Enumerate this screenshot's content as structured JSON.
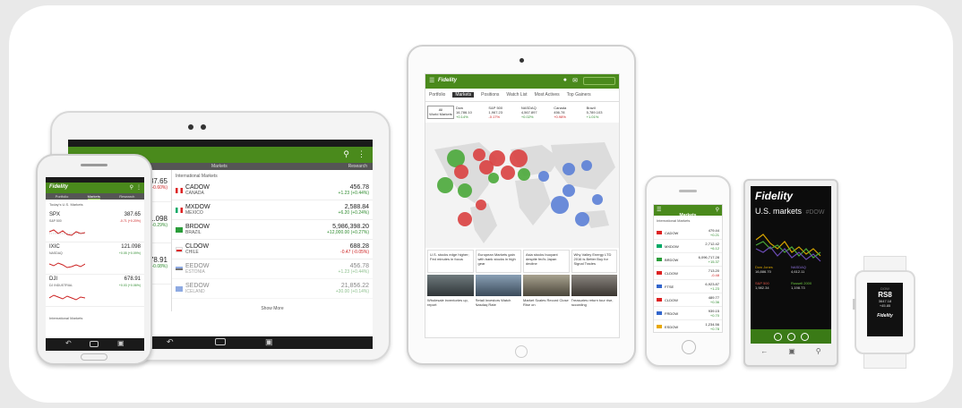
{
  "brand": "Fidelity",
  "tablet": {
    "bar_title": "Markets",
    "bar_right": "Research",
    "left_values": [
      {
        "value": "1,987.65",
        "change": "+11.86 (+0.60%)"
      },
      {
        "value": "4,321.098",
        "change": "+12.34 (+0.29%)"
      },
      {
        "value": "15,678.91",
        "change": "+12.34 (+0.08%)"
      }
    ],
    "section": "International Markets",
    "rows": [
      {
        "name": "CADOW",
        "sub": "CANADA",
        "value": "456.78",
        "change": "+1.23 (+0.44%)",
        "color": "#2e8b2e"
      },
      {
        "name": "MXDOW",
        "sub": "MEXICO",
        "value": "2,588.84",
        "change": "+6.20 (+0.24%)",
        "color": "#2e8b2e"
      },
      {
        "name": "BRDOW",
        "sub": "BRAZIL",
        "value": "5,986,398.20",
        "change": "+12,000.00 (+0.27%)",
        "color": "#2e8b2e"
      },
      {
        "name": "CLDOW",
        "sub": "CHILE",
        "value": "688.28",
        "change": "-0.47 (-0.05%)",
        "color": "#cc2020"
      },
      {
        "name": "EEDOW",
        "sub": "ESTONIA",
        "value": "456.78",
        "change": "+1.23 (+0.44%)",
        "color": "#2e8b2e"
      },
      {
        "name": "SEDOW",
        "sub": "ICELAND",
        "value": "21,856.22",
        "change": "+30.00 (+0.14%)",
        "color": "#2e8b2e"
      }
    ],
    "show_more": "Show More"
  },
  "phone": {
    "tabs": [
      "Portfolio",
      "Markets",
      "Research"
    ],
    "section": "Today's U.S. Markets",
    "items": [
      {
        "name": "SPX",
        "sub": "S&P 500",
        "value": "387.65",
        "change": "-0.71 (+0.20%)"
      },
      {
        "name": "IXIC",
        "sub": "NASDAQ",
        "value": "121.098",
        "change": "+0.05 (+0.09%)"
      },
      {
        "name": "DJI",
        "sub": "DJ INDUSTRIAL",
        "value": "678.91",
        "change": "+0.03 (+0.06%)"
      }
    ],
    "section2": "International Markets"
  },
  "ipad": {
    "tabs": [
      "Portfolio",
      "Markets",
      "Positions",
      "Watch List",
      "Most Actives",
      "Top Gainers"
    ],
    "indices": [
      {
        "name": "All",
        "sub": "World Markets",
        "value": "",
        "change": ""
      },
      {
        "name": "Dow",
        "sub": "",
        "value": "16,786.10",
        "change": "+0.14%"
      },
      {
        "name": "S&P 500",
        "sub": "",
        "value": "1,967.23",
        "change": "-0.17%"
      },
      {
        "name": "NASDAQ",
        "sub": "",
        "value": "4,567.897",
        "change": "+0.02%"
      },
      {
        "name": "Canada",
        "sub": "",
        "value": "456.78",
        "change": "+0.98%"
      },
      {
        "name": "Brazil",
        "sub": "",
        "value": "5,789.103",
        "change": "+1.01%"
      }
    ],
    "news": [
      {
        "text": "U.S. stocks edge higher; Fed minutes in focus"
      },
      {
        "text": "European Markets gain with bank stocks in high gear"
      },
      {
        "text": "Asia stocks buoyant despite fed's Japan decline"
      },
      {
        "text": "Why Valley Energy LTD 2016 is Better Buy for Signal Trades"
      }
    ],
    "news2": [
      {
        "text": "Wholesale inventories up, report"
      },
      {
        "text": "Retail Investors Watch Nasdaq Rate"
      },
      {
        "text": "Market Scales Record Close Rise on"
      },
      {
        "text": "Treasuries return tour rise, according"
      }
    ]
  },
  "iphone": {
    "title": "Markets",
    "section": "International Markets",
    "rows": [
      {
        "name": "CADOW",
        "value": "479.44",
        "change": "+0.21",
        "color": "#2e8b2e"
      },
      {
        "name": "MXDOW",
        "value": "2,712.42",
        "change": "+6.12",
        "color": "#2e8b2e"
      },
      {
        "name": "BRDOW",
        "value": "6,096,717.28",
        "change": "+15.37",
        "color": "#2e8b2e"
      },
      {
        "name": "CLDOW",
        "value": "713.20",
        "change": "-0.48",
        "color": "#cc2020"
      },
      {
        "name": "FTSE",
        "value": "6,923.87",
        "change": "+1.23",
        "color": "#2e8b2e"
      },
      {
        "name": "CLDOW",
        "value": "489.77",
        "change": "+0.36",
        "color": "#2e8b2e"
      },
      {
        "name": "FRDOW",
        "value": "939.15",
        "change": "+0.70",
        "color": "#2e8b2e"
      },
      {
        "name": "ESDOW",
        "value": "1,234.56",
        "change": "+0.78",
        "color": "#2e8b2e"
      }
    ]
  },
  "winphone": {
    "logo": "Fidelity",
    "heading": "U.S. markets",
    "faded": "#DOW",
    "tiles": [
      {
        "label": "Dow Jones",
        "value": "16,886.70",
        "color": "#d6a400"
      },
      {
        "label": "NASDAQ",
        "value": "4,612.11",
        "color": "#6b4bb5"
      },
      {
        "label": "S&P 500",
        "value": "1,982.34",
        "color": "#c0392b"
      },
      {
        "label": "Russell 2000",
        "value": "1,198.73",
        "color": "#4a8a1c"
      }
    ]
  },
  "watch": {
    "top": "DOW",
    "value": "RS8",
    "line2": "3647.18",
    "line3": "+45.85",
    "brand": "Fidelity"
  },
  "colors": {
    "brand_green": "#4a8a1c",
    "up": "#2e8b2e",
    "down": "#cc2020"
  }
}
